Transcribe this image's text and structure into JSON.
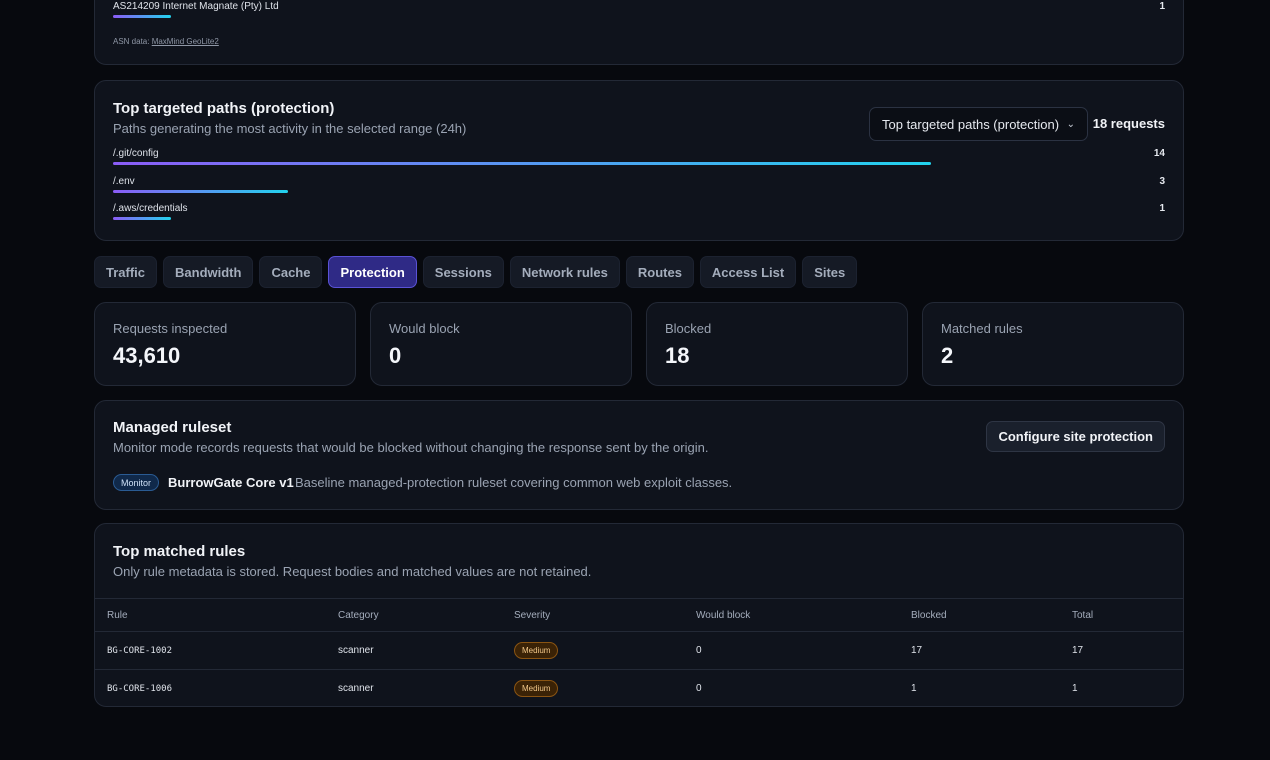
{
  "asn": {
    "name": "AS214209 Internet Magnate (Pty) Ltd",
    "count": "1",
    "note_prefix": "ASN data: ",
    "note_link": "MaxMind GeoLite2"
  },
  "paths": {
    "title": "Top targeted paths (protection)",
    "subtitle": "Paths generating the most activity in the selected range (24h)",
    "select_value": "Top targeted paths (protection)",
    "total": "18 requests",
    "items": [
      {
        "path": "/.git/config",
        "count": "14",
        "value": 14
      },
      {
        "path": "/.env",
        "count": "3",
        "value": 3
      },
      {
        "path": "/.aws/credentials",
        "count": "1",
        "value": 1
      }
    ]
  },
  "tabs": [
    {
      "label": "Traffic",
      "active": false
    },
    {
      "label": "Bandwidth",
      "active": false
    },
    {
      "label": "Cache",
      "active": false
    },
    {
      "label": "Protection",
      "active": true
    },
    {
      "label": "Sessions",
      "active": false
    },
    {
      "label": "Network rules",
      "active": false
    },
    {
      "label": "Routes",
      "active": false
    },
    {
      "label": "Access List",
      "active": false
    },
    {
      "label": "Sites",
      "active": false
    }
  ],
  "stats": [
    {
      "label": "Requests inspected",
      "value": "43,610"
    },
    {
      "label": "Would block",
      "value": "0"
    },
    {
      "label": "Blocked",
      "value": "18"
    },
    {
      "label": "Matched rules",
      "value": "2"
    }
  ],
  "ruleset": {
    "title": "Managed ruleset",
    "subtitle": "Monitor mode records requests that would be blocked without changing the response sent by the origin.",
    "configure_label": "Configure site protection",
    "mode": "Monitor",
    "name": "BurrowGate Core v1",
    "description": "Baseline managed-protection ruleset covering common web exploit classes."
  },
  "rules": {
    "title": "Top matched rules",
    "subtitle": "Only rule metadata is stored. Request bodies and matched values are not retained.",
    "columns": [
      "Rule",
      "Category",
      "Severity",
      "Would block",
      "Blocked",
      "Total"
    ],
    "rows": [
      {
        "rule": "BG-CORE-1002",
        "category": "scanner",
        "severity": "Medium",
        "would_block": "0",
        "blocked": "17",
        "total": "17"
      },
      {
        "rule": "BG-CORE-1006",
        "category": "scanner",
        "severity": "Medium",
        "would_block": "0",
        "blocked": "1",
        "total": "1"
      }
    ]
  },
  "colors": {
    "accent": "#2f2a86",
    "bar_start": "#8b5cf6",
    "bar_end": "#22d3ee",
    "severity_medium": "#f3c88a"
  }
}
